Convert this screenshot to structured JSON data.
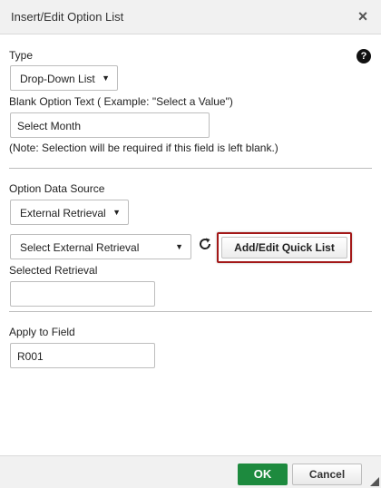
{
  "dialog": {
    "title": "Insert/Edit Option List",
    "close_label": "×"
  },
  "type_section": {
    "label": "Type",
    "select_value": "Drop-Down List",
    "help_label": "?",
    "blank_label": "Blank Option Text ( Example: \"Select a Value\")",
    "blank_value": "Select Month",
    "note": "(Note: Selection will be required if this field is left blank.)"
  },
  "source_section": {
    "label": "Option Data Source",
    "source_value": "External Retrieval",
    "retrieval_select_value": "Select External Retrieval",
    "quick_list_button": "Add/Edit Quick List",
    "selected_label": "Selected Retrieval",
    "selected_value": ""
  },
  "apply_section": {
    "label": "Apply to Field",
    "field_value": "R001"
  },
  "footer": {
    "ok_label": "OK",
    "cancel_label": "Cancel"
  },
  "colors": {
    "ok_green": "#1d8a3e",
    "highlight_red": "#a31818",
    "titlebar_bg": "#f1f1f1"
  },
  "icons": {
    "close": "close-icon",
    "help": "help-icon",
    "refresh": "refresh-icon",
    "caret": "chevron-down-icon",
    "resize": "resize-grip-icon"
  }
}
